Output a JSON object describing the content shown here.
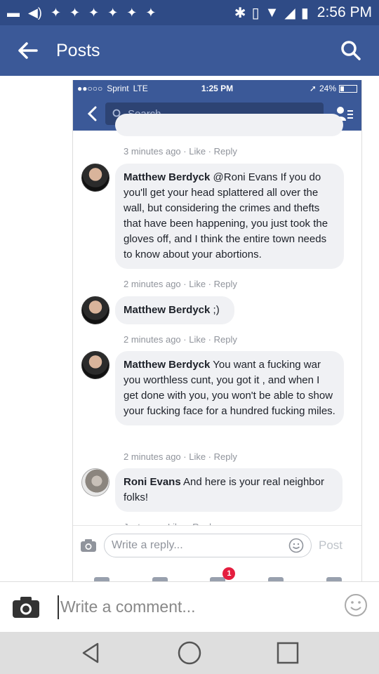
{
  "status_bar": {
    "time": "2:56 PM"
  },
  "header": {
    "title": "Posts"
  },
  "inner_status": {
    "carrier": "Sprint",
    "network": "LTE",
    "time": "1:25 PM",
    "battery": "24%"
  },
  "inner_search": {
    "placeholder": "Search"
  },
  "comments": [
    {
      "meta": "3 minutes ago · Like · Reply"
    },
    {
      "name": "Matthew Berdyck",
      "text": " @Roni Evans If you do you'll get your head splattered all over the wall, but considering the crimes and thefts that have been happening, you just took the gloves off, and I think the entire town needs to know about your abortions.",
      "meta": "2 minutes ago · Like · Reply"
    },
    {
      "name": "Matthew Berdyck",
      "text": " ;)",
      "meta": "2 minutes ago · Like · Reply"
    },
    {
      "name": "Matthew Berdyck",
      "text": " You want a fucking war you worthless cunt, you got it , and when I get done with you, you won't be able to show your fucking face for a hundred fucking miles.",
      "meta": "2 minutes ago · Like · Reply"
    },
    {
      "name": "Roni Evans",
      "text": " And here is your real neighbor folks!",
      "meta": "Just now · Like · Reply"
    }
  ],
  "reply": {
    "placeholder": "Write a reply...",
    "post_label": "Post"
  },
  "tabs": {
    "badge": "1"
  },
  "comment_bar": {
    "placeholder": "Write a comment..."
  }
}
